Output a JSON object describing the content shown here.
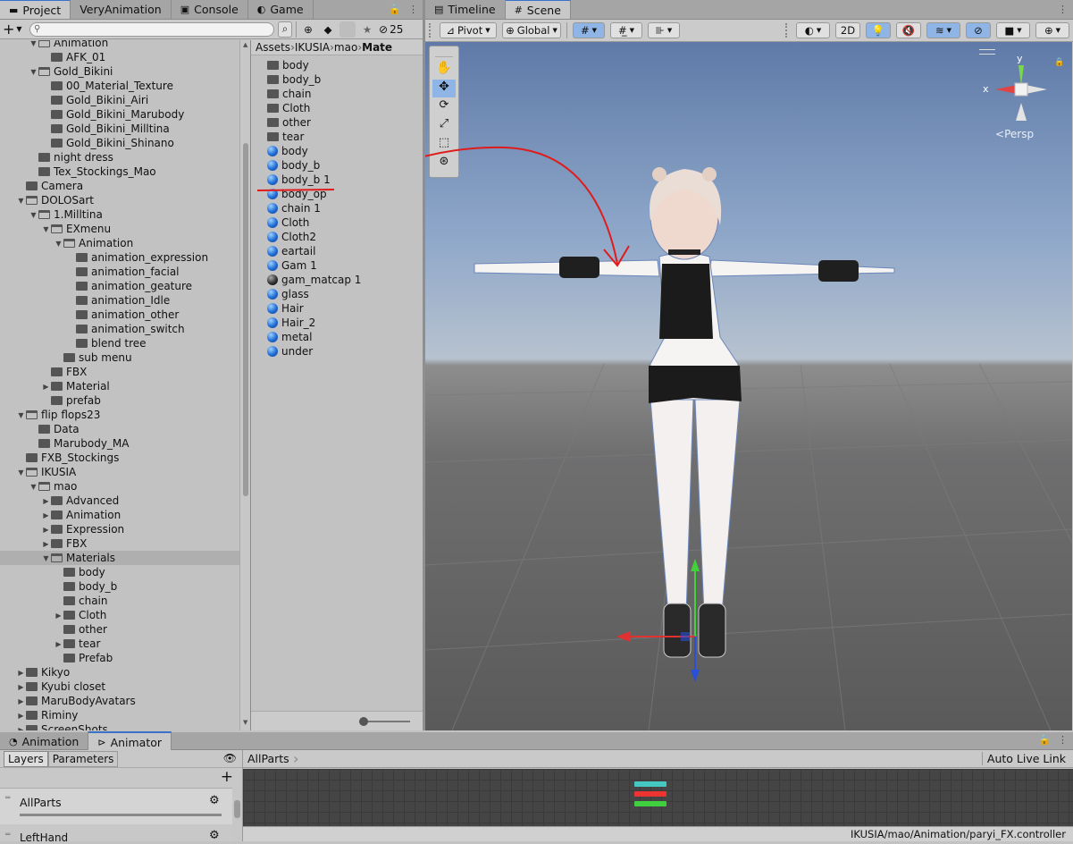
{
  "project_tabs": [
    {
      "label": "Project",
      "icon": "folder-icon"
    },
    {
      "label": "VeryAnimation",
      "icon": ""
    },
    {
      "label": "Console",
      "icon": "console-icon"
    },
    {
      "label": "Game",
      "icon": "gamepad-icon"
    }
  ],
  "scene_tabs": [
    {
      "label": "Timeline",
      "icon": "timeline-icon"
    },
    {
      "label": "Scene",
      "icon": "grid-icon"
    }
  ],
  "project_toolbar": {
    "add_label": "+",
    "hidden_count": "25",
    "search_value": ""
  },
  "breadcrumb": [
    "Assets",
    "IKUSIA",
    "mao",
    "Mate"
  ],
  "tree": [
    {
      "label": "Animation",
      "depth": 2,
      "fold": "open",
      "open": true
    },
    {
      "label": "AFK_01",
      "depth": 3,
      "fold": "",
      "open": false
    },
    {
      "label": "Gold_Bikini",
      "depth": 2,
      "fold": "open",
      "open": true
    },
    {
      "label": "00_Material_Texture",
      "depth": 3,
      "fold": "",
      "open": false
    },
    {
      "label": "Gold_Bikini_Airi",
      "depth": 3,
      "fold": "",
      "open": false
    },
    {
      "label": "Gold_Bikini_Marubody",
      "depth": 3,
      "fold": "",
      "open": false
    },
    {
      "label": "Gold_Bikini_Milltina",
      "depth": 3,
      "fold": "",
      "open": false
    },
    {
      "label": "Gold_Bikini_Shinano",
      "depth": 3,
      "fold": "",
      "open": false
    },
    {
      "label": "night dress",
      "depth": 2,
      "fold": "",
      "open": false
    },
    {
      "label": "Tex_Stockings_Mao",
      "depth": 2,
      "fold": "",
      "open": false
    },
    {
      "label": "Camera",
      "depth": 1,
      "fold": "",
      "open": false
    },
    {
      "label": "DOLOSart",
      "depth": 1,
      "fold": "open",
      "open": true
    },
    {
      "label": "1.Milltina",
      "depth": 2,
      "fold": "open",
      "open": true
    },
    {
      "label": "EXmenu",
      "depth": 3,
      "fold": "open",
      "open": true
    },
    {
      "label": "Animation",
      "depth": 4,
      "fold": "open",
      "open": true
    },
    {
      "label": "animation_expression",
      "depth": 5,
      "fold": "",
      "open": false
    },
    {
      "label": "animation_facial",
      "depth": 5,
      "fold": "",
      "open": false
    },
    {
      "label": "animation_geature",
      "depth": 5,
      "fold": "",
      "open": false
    },
    {
      "label": "animation_Idle",
      "depth": 5,
      "fold": "",
      "open": false
    },
    {
      "label": "animation_other",
      "depth": 5,
      "fold": "",
      "open": false
    },
    {
      "label": "animation_switch",
      "depth": 5,
      "fold": "",
      "open": false
    },
    {
      "label": "blend tree",
      "depth": 5,
      "fold": "",
      "open": false
    },
    {
      "label": "sub menu",
      "depth": 4,
      "fold": "",
      "open": false
    },
    {
      "label": "FBX",
      "depth": 3,
      "fold": "",
      "open": false
    },
    {
      "label": "Material",
      "depth": 3,
      "fold": "closed",
      "open": false
    },
    {
      "label": "prefab",
      "depth": 3,
      "fold": "",
      "open": false
    },
    {
      "label": "flip flops23",
      "depth": 1,
      "fold": "open",
      "open": true
    },
    {
      "label": "Data",
      "depth": 2,
      "fold": "",
      "open": false
    },
    {
      "label": "Marubody_MA",
      "depth": 2,
      "fold": "",
      "open": false
    },
    {
      "label": "FXB_Stockings",
      "depth": 1,
      "fold": "",
      "open": false
    },
    {
      "label": "IKUSIA",
      "depth": 1,
      "fold": "open",
      "open": true
    },
    {
      "label": "mao",
      "depth": 2,
      "fold": "open",
      "open": true
    },
    {
      "label": "Advanced",
      "depth": 3,
      "fold": "closed",
      "open": false
    },
    {
      "label": "Animation",
      "depth": 3,
      "fold": "closed",
      "open": false
    },
    {
      "label": "Expression",
      "depth": 3,
      "fold": "closed",
      "open": false
    },
    {
      "label": "FBX",
      "depth": 3,
      "fold": "closed",
      "open": false
    },
    {
      "label": "Materials",
      "depth": 3,
      "fold": "open",
      "open": true,
      "selected": true
    },
    {
      "label": "body",
      "depth": 4,
      "fold": "",
      "open": false
    },
    {
      "label": "body_b",
      "depth": 4,
      "fold": "",
      "open": false
    },
    {
      "label": "chain",
      "depth": 4,
      "fold": "",
      "open": false
    },
    {
      "label": "Cloth",
      "depth": 4,
      "fold": "closed",
      "open": false
    },
    {
      "label": "other",
      "depth": 4,
      "fold": "",
      "open": false
    },
    {
      "label": "tear",
      "depth": 4,
      "fold": "closed",
      "open": false
    },
    {
      "label": "Prefab",
      "depth": 4,
      "fold": "",
      "open": false
    },
    {
      "label": "Kikyo",
      "depth": 1,
      "fold": "closed",
      "open": false
    },
    {
      "label": "Kyubi closet",
      "depth": 1,
      "fold": "closed",
      "open": false
    },
    {
      "label": "MaruBodyAvatars",
      "depth": 1,
      "fold": "closed",
      "open": false
    },
    {
      "label": "Riminy",
      "depth": 1,
      "fold": "closed",
      "open": false
    },
    {
      "label": "ScreenShots",
      "depth": 1,
      "fold": "closed",
      "open": false
    }
  ],
  "assets": [
    {
      "label": "body",
      "kind": "folder"
    },
    {
      "label": "body_b",
      "kind": "folder"
    },
    {
      "label": "chain",
      "kind": "folder"
    },
    {
      "label": "Cloth",
      "kind": "folder"
    },
    {
      "label": "other",
      "kind": "folder"
    },
    {
      "label": "tear",
      "kind": "folder"
    },
    {
      "label": "body",
      "kind": "material"
    },
    {
      "label": "body_b",
      "kind": "material"
    },
    {
      "label": "body_b 1",
      "kind": "material"
    },
    {
      "label": "body_op",
      "kind": "material"
    },
    {
      "label": "chain 1",
      "kind": "material"
    },
    {
      "label": "Cloth",
      "kind": "material"
    },
    {
      "label": "Cloth2",
      "kind": "material"
    },
    {
      "label": "eartail",
      "kind": "material"
    },
    {
      "label": "Gam 1",
      "kind": "material"
    },
    {
      "label": "gam_matcap 1",
      "kind": "matcap"
    },
    {
      "label": "glass",
      "kind": "material"
    },
    {
      "label": "Hair",
      "kind": "material"
    },
    {
      "label": "Hair_2",
      "kind": "material"
    },
    {
      "label": "metal",
      "kind": "material"
    },
    {
      "label": "under",
      "kind": "material"
    }
  ],
  "scene_toolbar": {
    "pivot_label": "Pivot",
    "global_label": "Global",
    "mode_2d_label": "2D"
  },
  "gizmo": {
    "persp_label": "Persp",
    "y_label": "y",
    "x_label": "x"
  },
  "bottom_tabs": [
    {
      "label": "Animation",
      "icon": "animation-icon"
    },
    {
      "label": "Animator",
      "icon": "animator-icon"
    }
  ],
  "animator": {
    "layers_tab": "Layers",
    "parameters_tab": "Parameters",
    "breadcrumb": "AllParts",
    "auto_live_link": "Auto Live Link",
    "layers": [
      {
        "name": "AllParts"
      },
      {
        "name": "LeftHand"
      }
    ],
    "status_path": "IKUSIA/mao/Animation/paryi_FX.controller"
  },
  "colors": {
    "accent": "#3a72c9",
    "selection": "#afafaf",
    "annotation_red": "#e01b1b"
  }
}
